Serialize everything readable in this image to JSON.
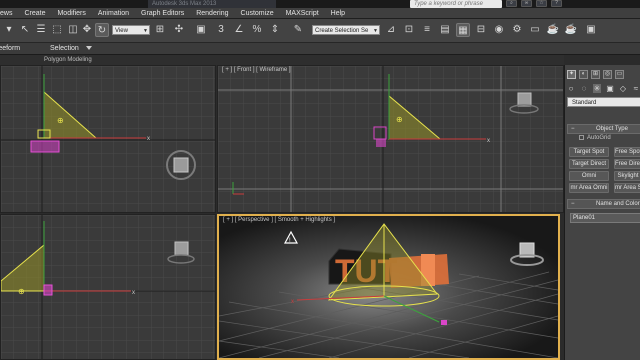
{
  "window": {
    "title": "Autodesk 3ds Max 2013",
    "help_placeholder": "Type a keyword or phrase",
    "title_icons": [
      "search-icon",
      "binoculars-icon",
      "star-icon",
      "help-icon"
    ]
  },
  "menu": [
    "ews",
    "Create",
    "Modifiers",
    "Animation",
    "Graph Editors",
    "Rendering",
    "Customize",
    "MAXScript",
    "Help"
  ],
  "toolbar": {
    "view_dropdown": "View",
    "selection_set_placeholder": "Create Selection Se"
  },
  "ribbon": {
    "tab_freeform": "reeform",
    "tab_selection": "Selection",
    "subtitle": "Polygon Modeling"
  },
  "viewports": {
    "top_left": {
      "label": ""
    },
    "front": {
      "label": "[ + ] [ Front ] [ Wireframe ]"
    },
    "bottom_left": {
      "label": ""
    },
    "perspective": {
      "label": "[ + ] [ Perspective ] [ Smooth + Highlights ]",
      "scene_text": "TUT"
    }
  },
  "command_panel": {
    "category_dropdown": "Standard",
    "object_type": {
      "title": "Object Type",
      "autogrid": "AutoGrid",
      "buttons": [
        "Target Spot",
        "Free Spot",
        "Target Direct",
        "Free Direct",
        "Omni",
        "Skylight",
        "mr Area Omni",
        "mr Area Spot"
      ]
    },
    "name_color": {
      "title": "Name and Color",
      "name_value": "Plane01"
    }
  },
  "colors": {
    "viewport_bg": "#393939",
    "grid": "#4c4c4c",
    "active_border": "#e1b04d",
    "light_cone": "#d9d64a",
    "selection": "#d946c8"
  }
}
